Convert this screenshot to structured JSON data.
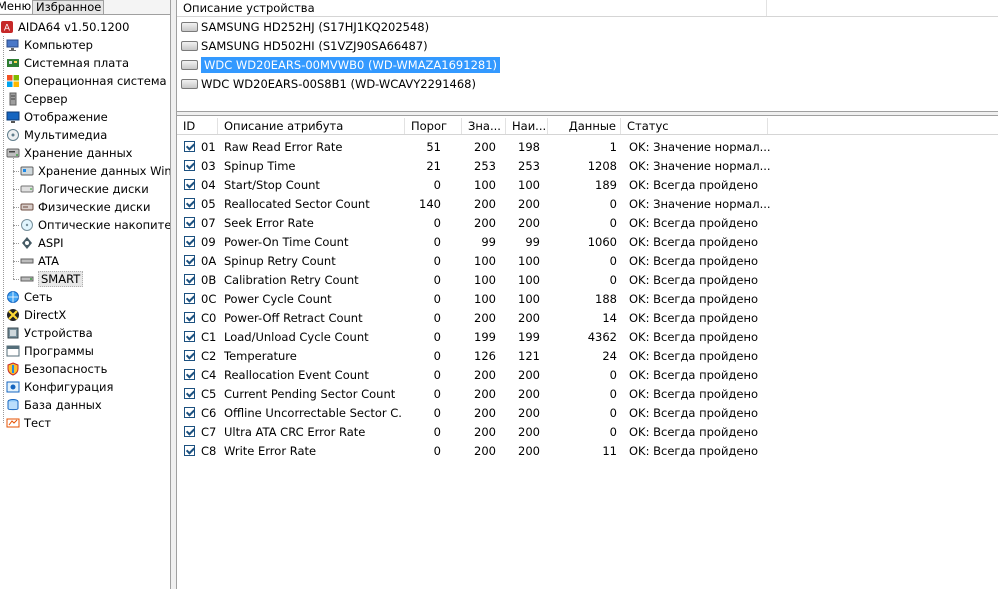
{
  "tabs": {
    "menu": "Меню",
    "favorites": "Избранное"
  },
  "tree": [
    {
      "label": "AIDA64 v1.50.1200",
      "icon": "aida64-logo-icon",
      "level": 0
    },
    {
      "label": "Компьютер",
      "icon": "computer-icon",
      "level": 1
    },
    {
      "label": "Системная плата",
      "icon": "motherboard-icon",
      "level": 1
    },
    {
      "label": "Операционная система",
      "icon": "windows-logo-icon",
      "level": 1
    },
    {
      "label": "Сервер",
      "icon": "server-icon",
      "level": 1
    },
    {
      "label": "Отображение",
      "icon": "monitor-icon",
      "level": 1
    },
    {
      "label": "Мультимедиа",
      "icon": "multimedia-icon",
      "level": 1
    },
    {
      "label": "Хранение данных",
      "icon": "storage-icon",
      "level": 1
    },
    {
      "label": "Хранение данных Win",
      "icon": "storage-win-icon",
      "level": 2
    },
    {
      "label": "Логические диски",
      "icon": "logical-drive-icon",
      "level": 2
    },
    {
      "label": "Физические диски",
      "icon": "physical-drive-icon",
      "level": 2
    },
    {
      "label": "Оптические накопите",
      "icon": "optical-drive-icon",
      "level": 2
    },
    {
      "label": "ASPI",
      "icon": "aspi-icon",
      "level": 2
    },
    {
      "label": "ATA",
      "icon": "ata-icon",
      "level": 2
    },
    {
      "label": "SMART",
      "icon": "smart-icon",
      "level": 2,
      "selected": true
    },
    {
      "label": "Сеть",
      "icon": "network-icon",
      "level": 1
    },
    {
      "label": "DirectX",
      "icon": "directx-icon",
      "level": 1
    },
    {
      "label": "Устройства",
      "icon": "devices-icon",
      "level": 1
    },
    {
      "label": "Программы",
      "icon": "programs-icon",
      "level": 1
    },
    {
      "label": "Безопасность",
      "icon": "security-shield-icon",
      "level": 1
    },
    {
      "label": "Конфигурация",
      "icon": "configuration-icon",
      "level": 1
    },
    {
      "label": "База данных",
      "icon": "database-icon",
      "level": 1
    },
    {
      "label": "Тест",
      "icon": "benchmark-icon",
      "level": 1
    }
  ],
  "device_header": "Описание устройства",
  "devices": [
    {
      "label": "SAMSUNG HD252HJ (S17HJ1KQ202548)"
    },
    {
      "label": "SAMSUNG HD502HI (S1VZJ90SA66487)"
    },
    {
      "label": "WDC WD20EARS-00MVWB0 (WD-WMAZA1691281)",
      "selected": true
    },
    {
      "label": "WDC WD20EARS-00S8B1 (WD-WCAVY2291468)"
    }
  ],
  "columns": {
    "id": "ID",
    "desc": "Описание атрибута",
    "thresh": "Порог",
    "value": "Зна...",
    "worst": "Наи...",
    "data": "Данные",
    "status": "Статус"
  },
  "rows": [
    {
      "id": "01",
      "desc": "Raw Read Error Rate",
      "thresh": "51",
      "value": "200",
      "worst": "198",
      "data": "1",
      "status": "OK: Значение нормал..."
    },
    {
      "id": "03",
      "desc": "Spinup Time",
      "thresh": "21",
      "value": "253",
      "worst": "253",
      "data": "1208",
      "status": "OK: Значение нормал..."
    },
    {
      "id": "04",
      "desc": "Start/Stop Count",
      "thresh": "0",
      "value": "100",
      "worst": "100",
      "data": "189",
      "status": "OK: Всегда пройдено"
    },
    {
      "id": "05",
      "desc": "Reallocated Sector Count",
      "thresh": "140",
      "value": "200",
      "worst": "200",
      "data": "0",
      "status": "OK: Значение нормал..."
    },
    {
      "id": "07",
      "desc": "Seek Error Rate",
      "thresh": "0",
      "value": "200",
      "worst": "200",
      "data": "0",
      "status": "OK: Всегда пройдено"
    },
    {
      "id": "09",
      "desc": "Power-On Time Count",
      "thresh": "0",
      "value": "99",
      "worst": "99",
      "data": "1060",
      "status": "OK: Всегда пройдено"
    },
    {
      "id": "0A",
      "desc": "Spinup Retry Count",
      "thresh": "0",
      "value": "100",
      "worst": "100",
      "data": "0",
      "status": "OK: Всегда пройдено"
    },
    {
      "id": "0B",
      "desc": "Calibration Retry Count",
      "thresh": "0",
      "value": "100",
      "worst": "100",
      "data": "0",
      "status": "OK: Всегда пройдено"
    },
    {
      "id": "0C",
      "desc": "Power Cycle Count",
      "thresh": "0",
      "value": "100",
      "worst": "100",
      "data": "188",
      "status": "OK: Всегда пройдено"
    },
    {
      "id": "C0",
      "desc": "Power-Off Retract Count",
      "thresh": "0",
      "value": "200",
      "worst": "200",
      "data": "14",
      "status": "OK: Всегда пройдено"
    },
    {
      "id": "C1",
      "desc": "Load/Unload Cycle Count",
      "thresh": "0",
      "value": "199",
      "worst": "199",
      "data": "4362",
      "status": "OK: Всегда пройдено"
    },
    {
      "id": "C2",
      "desc": "Temperature",
      "thresh": "0",
      "value": "126",
      "worst": "121",
      "data": "24",
      "status": "OK: Всегда пройдено"
    },
    {
      "id": "C4",
      "desc": "Reallocation Event Count",
      "thresh": "0",
      "value": "200",
      "worst": "200",
      "data": "0",
      "status": "OK: Всегда пройдено"
    },
    {
      "id": "C5",
      "desc": "Current Pending Sector Count",
      "thresh": "0",
      "value": "200",
      "worst": "200",
      "data": "0",
      "status": "OK: Всегда пройдено"
    },
    {
      "id": "C6",
      "desc": "Offline Uncorrectable Sector C...",
      "thresh": "0",
      "value": "200",
      "worst": "200",
      "data": "0",
      "status": "OK: Всегда пройдено"
    },
    {
      "id": "C7",
      "desc": "Ultra ATA CRC Error Rate",
      "thresh": "0",
      "value": "200",
      "worst": "200",
      "data": "0",
      "status": "OK: Всегда пройдено"
    },
    {
      "id": "C8",
      "desc": "Write Error Rate",
      "thresh": "0",
      "value": "200",
      "worst": "200",
      "data": "11",
      "status": "OK: Всегда пройдено"
    }
  ],
  "colors": {
    "selection": "#3399ff",
    "checkbox": "#1c5180",
    "splitter": "#f0f0f0"
  }
}
